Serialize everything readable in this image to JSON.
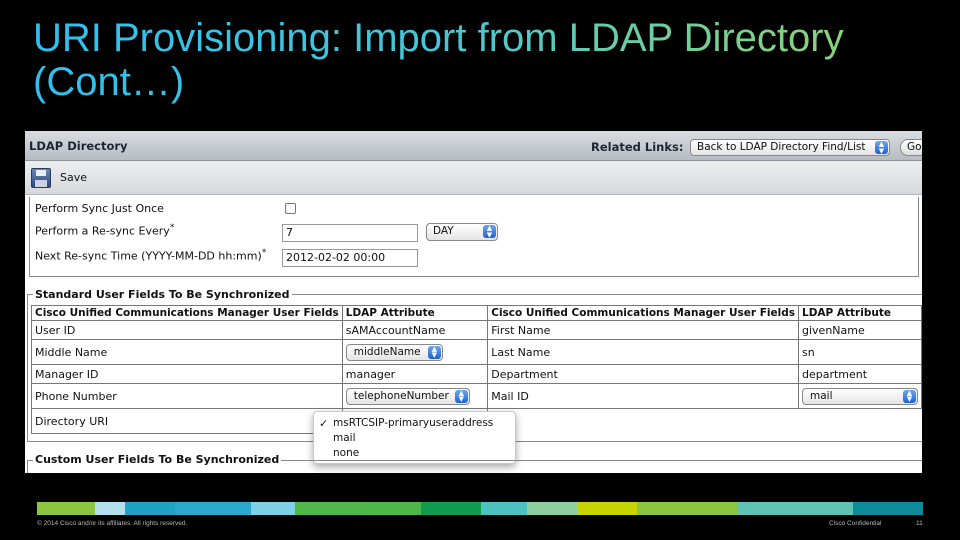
{
  "slide": {
    "title_line1": "URI Provisioning: Import from LDAP Directory",
    "title_line2": "(Cont…)"
  },
  "header": {
    "title": "LDAP Directory",
    "related_links_label": "Related Links:",
    "related_links_value": "Back to LDAP Directory Find/List",
    "go_label": "Go"
  },
  "toolbar": {
    "save_label": "Save",
    "save_icon": "floppy-disk-icon"
  },
  "sync": {
    "sync_once_label": "Perform Sync Just Once",
    "resync_every_label": "Perform a Re-sync Every",
    "resync_every_value": "7",
    "resync_unit": "DAY",
    "next_resync_label": "Next Re-sync Time (YYYY-MM-DD hh:mm)",
    "next_resync_value": "2012-02-02 00:00",
    "required_mark": "*"
  },
  "standard_fields": {
    "legend": "Standard User Fields To Be Synchronized",
    "headers": [
      "Cisco Unified Communications Manager User Fields",
      "LDAP Attribute",
      "Cisco Unified Communications Manager User Fields",
      "LDAP Attribute"
    ],
    "rows": [
      [
        "User ID",
        "sAMAccountName",
        "First Name",
        "givenName"
      ],
      [
        "Middle Name",
        "middleName",
        "Last Name",
        "sn"
      ],
      [
        "Manager ID",
        "manager",
        "Department",
        "department"
      ],
      [
        "Phone Number",
        "telephoneNumber",
        "Mail ID",
        "mail"
      ],
      [
        "Directory URI",
        "msRTCSIP-primaryuseraddress"
      ]
    ]
  },
  "uri_dropdown": {
    "check_mark": "✓",
    "options": [
      "msRTCSIP-primaryuseraddress",
      "mail",
      "none"
    ],
    "selected": "msRTCSIP-primaryuseraddress"
  },
  "custom_fields": {
    "legend": "Custom User Fields To Be Synchronized"
  },
  "footer": {
    "copyright": "© 2014 Cisco and/or its affiliates. All rights reserved.",
    "confidential": "Cisco Confidential",
    "page_number": "11"
  },
  "colors": {
    "title_gradient_start": "#2ec0ee",
    "title_gradient_end": "#90d36a",
    "stripe": [
      "#8cc63f",
      "#b3e0ec",
      "#1fa3c4",
      "#2aa9d0",
      "#7dd0e6",
      "#50b848",
      "#4db848",
      "#0f9e4f",
      "#4cc1bf",
      "#8fd0a0",
      "#c8d400",
      "#8cc63f",
      "#5fc3b3",
      "#0c8c9a"
    ]
  }
}
